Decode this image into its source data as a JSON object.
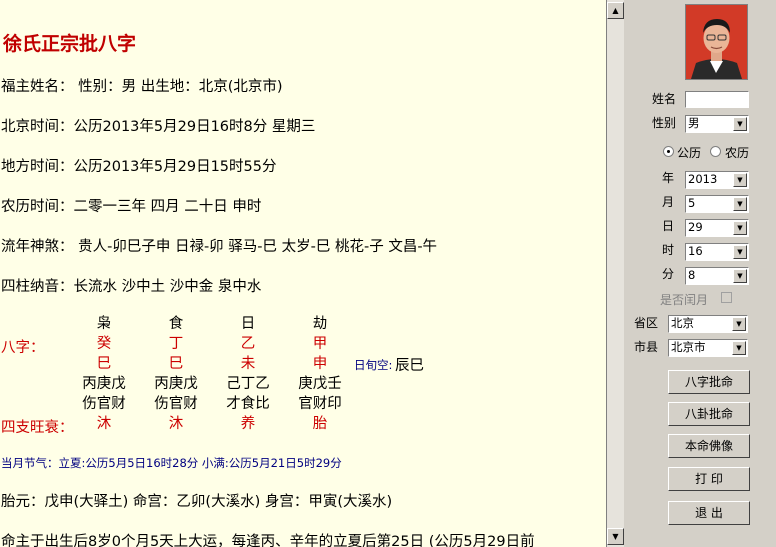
{
  "title": "徐氏正宗批八字",
  "lines": {
    "owner": "福主姓名：  性别：男   出生地：北京(北京市)",
    "beijing_time": "北京时间：公历2013年5月29日16时8分  星期三",
    "local_time": "地方时间：公历2013年5月29日15时55分",
    "lunar_time": "农历时间：二零一三年 四月  二十日  申时",
    "shensha": "流年神煞：  贵人-卯巳子申  日禄-卯  驿马-巳  太岁-巳  桃花-子  文昌-午",
    "nayin": "四柱纳音：长流水     沙中土     沙中金     泉中水"
  },
  "bazi": {
    "label": "八字：",
    "wangshuai_label": "四支旺衰：",
    "xunkong_label": "日旬空:",
    "xunkong_value": "辰巳",
    "pillars": [
      {
        "ten_god": "枭",
        "stem": "癸",
        "branch": "巳",
        "hidden": "丙庚戊",
        "hidden_gods": "伤官财",
        "state": "沐"
      },
      {
        "ten_god": "食",
        "stem": "丁",
        "branch": "巳",
        "hidden": "丙庚戊",
        "hidden_gods": "伤官财",
        "state": "沐"
      },
      {
        "ten_god": "日",
        "stem": "乙",
        "branch": "未",
        "hidden": "己丁乙",
        "hidden_gods": "才食比",
        "state": "养"
      },
      {
        "ten_god": "劫",
        "stem": "甲",
        "branch": "申",
        "hidden": "庚戊壬",
        "hidden_gods": "官财印",
        "state": "胎"
      }
    ]
  },
  "jieqi": "当月节气：立夏:公历5月5日16时28分 小满:公历5月21日5时29分",
  "taiyuan": "胎元：戊申(大驿土)    命宫：乙卯(大溪水)    身宫：甲寅(大溪水)",
  "dayun": "命主于出生后8岁0个月5天上大运，每逢丙、辛年的立夏后第25日 (公历5月29日前",
  "scrollbar": {
    "up": "▲",
    "down": "▼"
  },
  "form": {
    "name_label": "姓名",
    "name_value": "",
    "gender_label": "性别",
    "gender_value": "男",
    "calendar_solar": "公历",
    "calendar_lunar": "农历",
    "year_label": "年",
    "year_value": "2013",
    "month_label": "月",
    "month_value": "5",
    "day_label": "日",
    "day_value": "29",
    "hour_label": "时",
    "hour_value": "16",
    "minute_label": "分",
    "minute_value": "8",
    "leap_label": "是否闰月",
    "province_label": "省区",
    "province_value": "北京",
    "county_label": "市县",
    "county_value": "北京市",
    "dropdown_arrow": "▼"
  },
  "buttons": {
    "bazi": "八字批命",
    "bagua": "八卦批命",
    "buddha": "本命佛像",
    "print": "打 印",
    "exit": "退 出"
  },
  "colors": {
    "content_bg": "#ffffe7",
    "title": "#c00000",
    "accent_red": "#cc0000",
    "blue_text": "#000080"
  }
}
